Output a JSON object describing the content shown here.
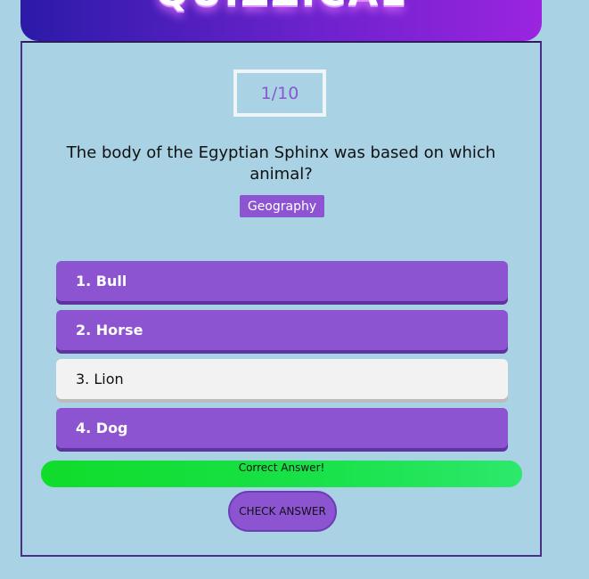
{
  "app": {
    "logo_text": "QUIZZICAL"
  },
  "quiz": {
    "counter": "1/10",
    "question": "The body of the Egyptian Sphinx was based on which animal?",
    "category": "Geography",
    "answers": [
      {
        "label": "1. Bull",
        "state": "default"
      },
      {
        "label": "2. Horse",
        "state": "default"
      },
      {
        "label": "3. Lion",
        "state": "selected"
      },
      {
        "label": "4. Dog",
        "state": "default"
      }
    ],
    "result_text": "Correct Answer!",
    "check_button_label": "CHECK ANSWER"
  },
  "colors": {
    "background": "#a9d2e4",
    "accent": "#8d54d2",
    "selected": "#f2f2f2",
    "success": "#19e24a",
    "header_start": "#2b1aa8",
    "header_end": "#9b24e0"
  }
}
